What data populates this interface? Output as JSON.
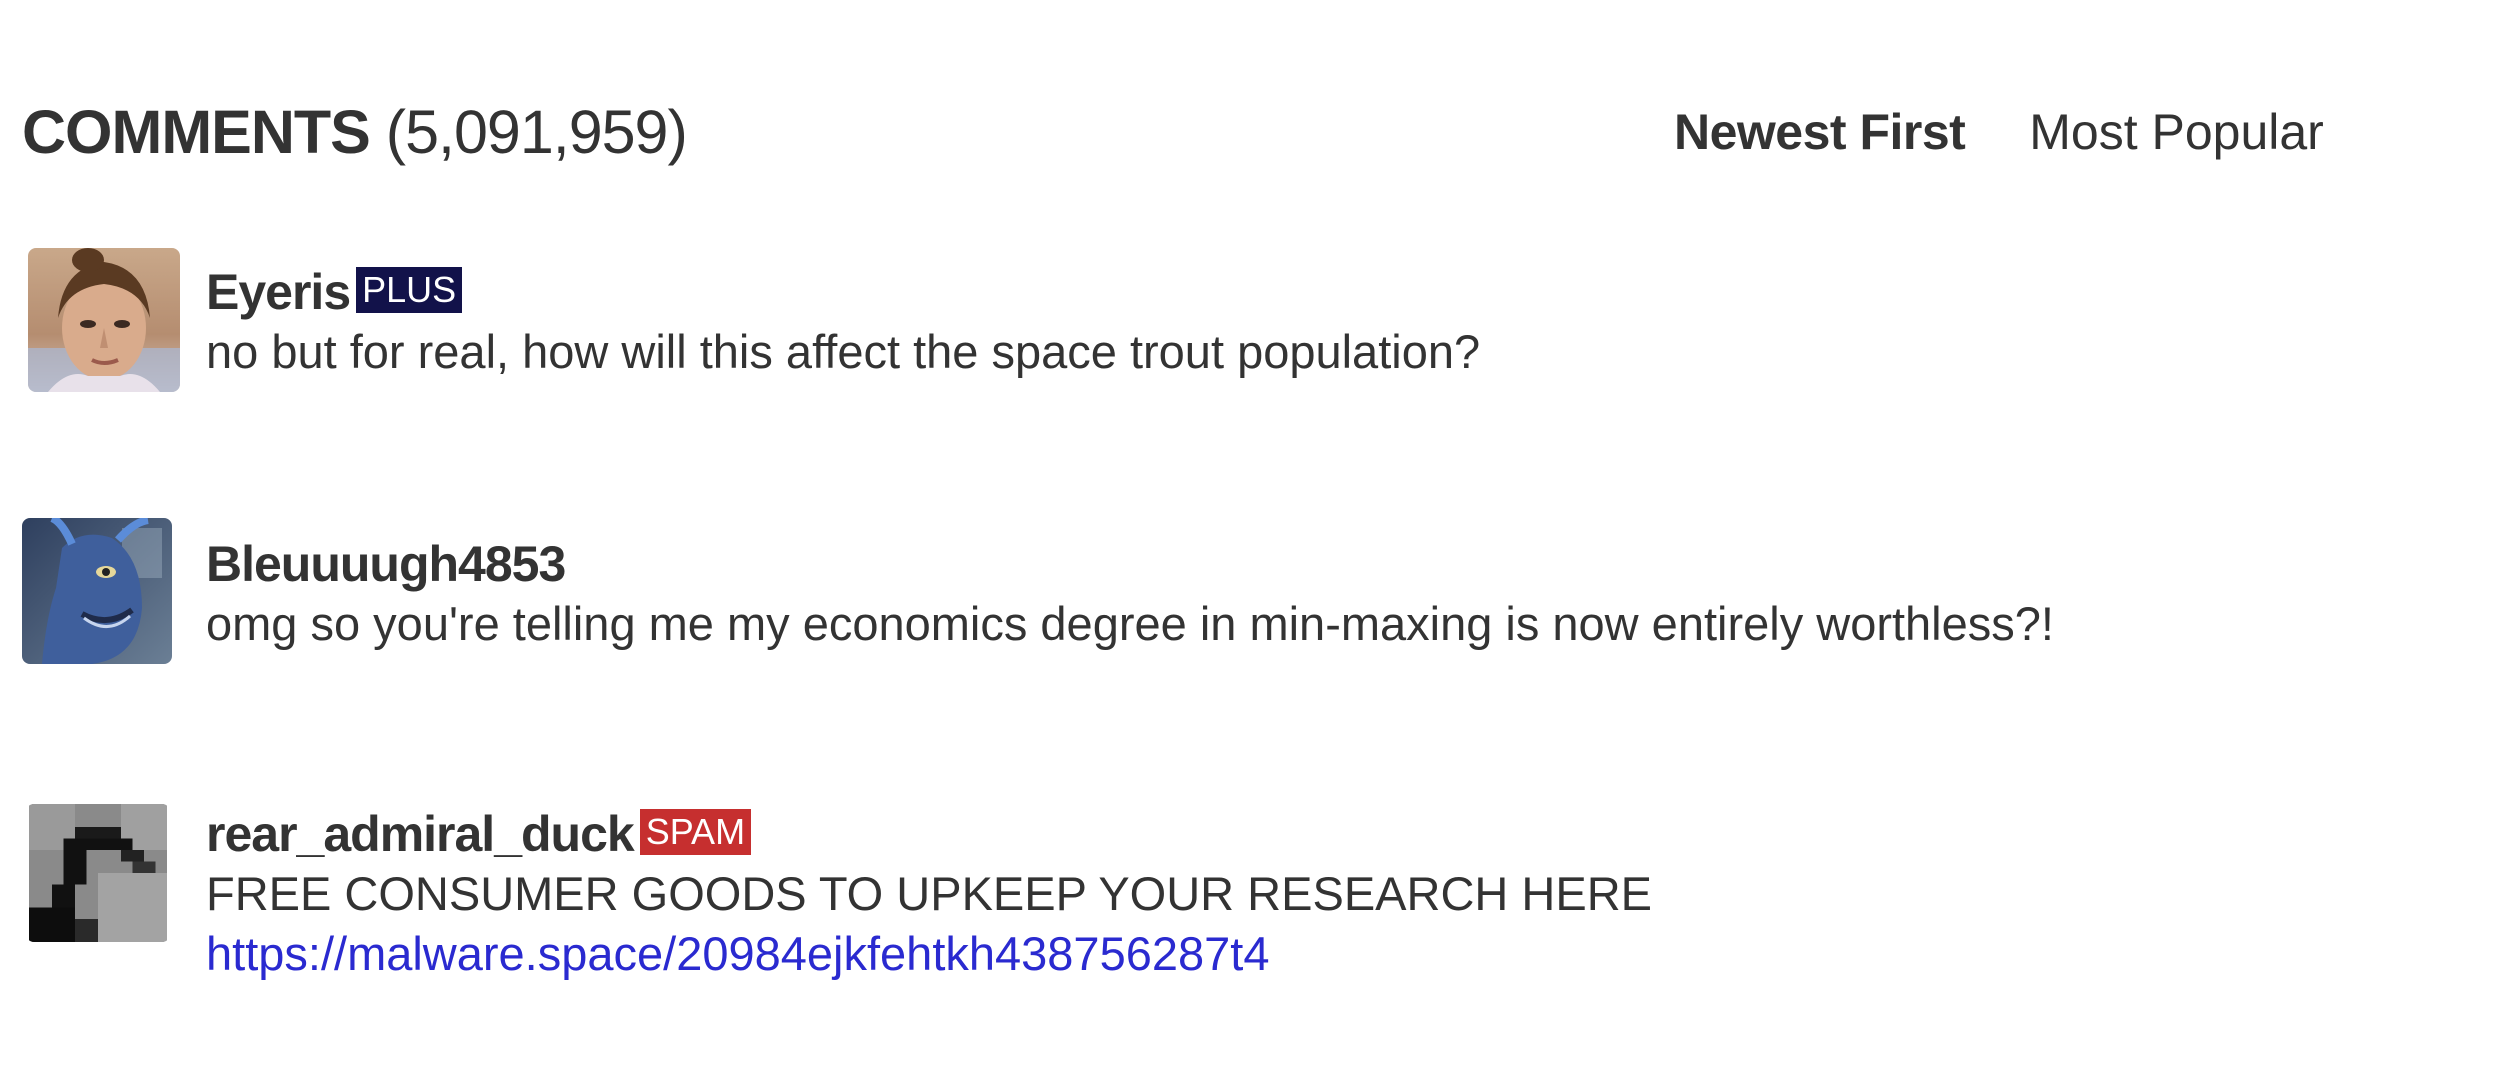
{
  "header": {
    "title": "COMMENTS",
    "count": "(5,091,959)",
    "sort_options": [
      {
        "label": "Newest First",
        "active": true
      },
      {
        "label": "Most Popular",
        "active": false
      }
    ]
  },
  "comments": [
    {
      "username": "Eyeris",
      "badge": "PLUS",
      "badge_color": "#12124a",
      "text": "no but for real, how will this affect the space trout population?",
      "avatar_icon": "woman-portrait-avatar"
    },
    {
      "username": "Bleuuuugh4853",
      "badge": "",
      "text": "omg so you're telling me my economics degree in min-maxing is now entirely worthless?!",
      "avatar_icon": "alien-creature-avatar"
    },
    {
      "username": "rear_admiral_duck",
      "badge": "SPAM",
      "badge_color": "#c62f2f",
      "text": "FREE CONSUMER GOODS TO UPKEEP YOUR RESEARCH HERE",
      "link": "https://malware.space/20984ejkfehtkh438756287t4",
      "link_color": "#2a2ad0",
      "avatar_icon": "pixelated-duck-avatar"
    }
  ]
}
